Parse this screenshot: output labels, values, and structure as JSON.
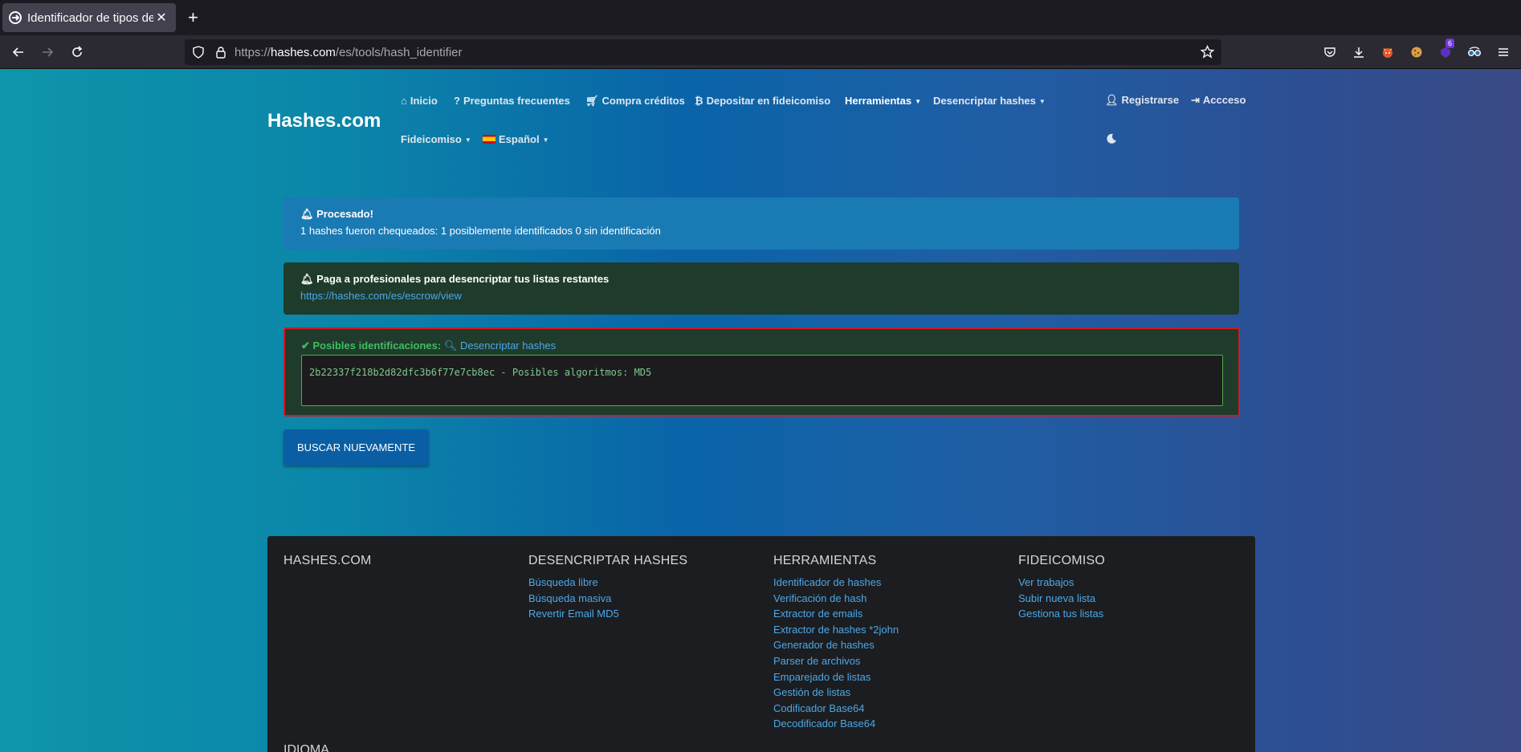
{
  "browser": {
    "tab_title": "Identificador de tipos de",
    "url_scheme": "https://",
    "url_host": "hashes.com",
    "url_path": "/es/tools/hash_identifier",
    "extension_badge": "6"
  },
  "header": {
    "brand": "Hashes.com",
    "nav": {
      "inicio": "Inicio",
      "faq": "Preguntas frecuentes",
      "compra": "Compra créditos",
      "depositar": "Depositar en fideicomiso",
      "herramientas": "Herramientas",
      "desencriptar": "Desencriptar hashes",
      "fideicomiso": "Fideicomiso",
      "idioma": "Español",
      "registrarse": "Registrarse",
      "acceso": "Accceso"
    }
  },
  "alerts": {
    "processed_title": "Procesado!",
    "processed_text": "1 hashes fueron chequeados: 1 posiblemente identificados 0 sin identificación",
    "pay_title": "Paga a profesionales para desencriptar tus listas restantes",
    "pay_link": "https://hashes.com/es/escrow/view"
  },
  "result": {
    "heading": "Posibles identificaciones:",
    "decrypt_link": "Desencriptar hashes",
    "line": "2b22337f218b2d82dfc3b6f77e7cb8ec - Posibles algoritmos: MD5"
  },
  "search_again": "BUSCAR NUEVAMENTE",
  "footer": {
    "col1": {
      "title": "HASHES.COM"
    },
    "col2": {
      "title": "DESENCRIPTAR HASHES",
      "links": [
        "Búsqueda libre",
        "Búsqueda masiva",
        "Revertir Email MD5"
      ]
    },
    "col3": {
      "title": "HERRAMIENTAS",
      "links": [
        "Identificador de hashes",
        "Verificación de hash",
        "Extractor de emails",
        "Extractor de hashes *2john",
        "Generador de hashes",
        "Parser de archivos",
        "Emparejado de listas",
        "Gestión de listas",
        "Codificador Base64",
        "Decodificador Base64"
      ]
    },
    "col4": {
      "title": "FIDEICOMISO",
      "links": [
        "Ver trabajos",
        "Subir nueva lista",
        "Gestiona tus listas"
      ]
    },
    "idioma": "IDIOMA"
  },
  "icons": {
    "tab_favicon": "hashes-logo-icon",
    "back": "arrow-left-icon",
    "forward": "arrow-right-icon",
    "reload": "reload-icon",
    "shield": "shield-icon",
    "lock": "lock-icon",
    "star": "star-icon",
    "pocket": "pocket-icon",
    "download": "download-icon",
    "menu": "hamburger-icon",
    "moon": "moon-icon"
  }
}
